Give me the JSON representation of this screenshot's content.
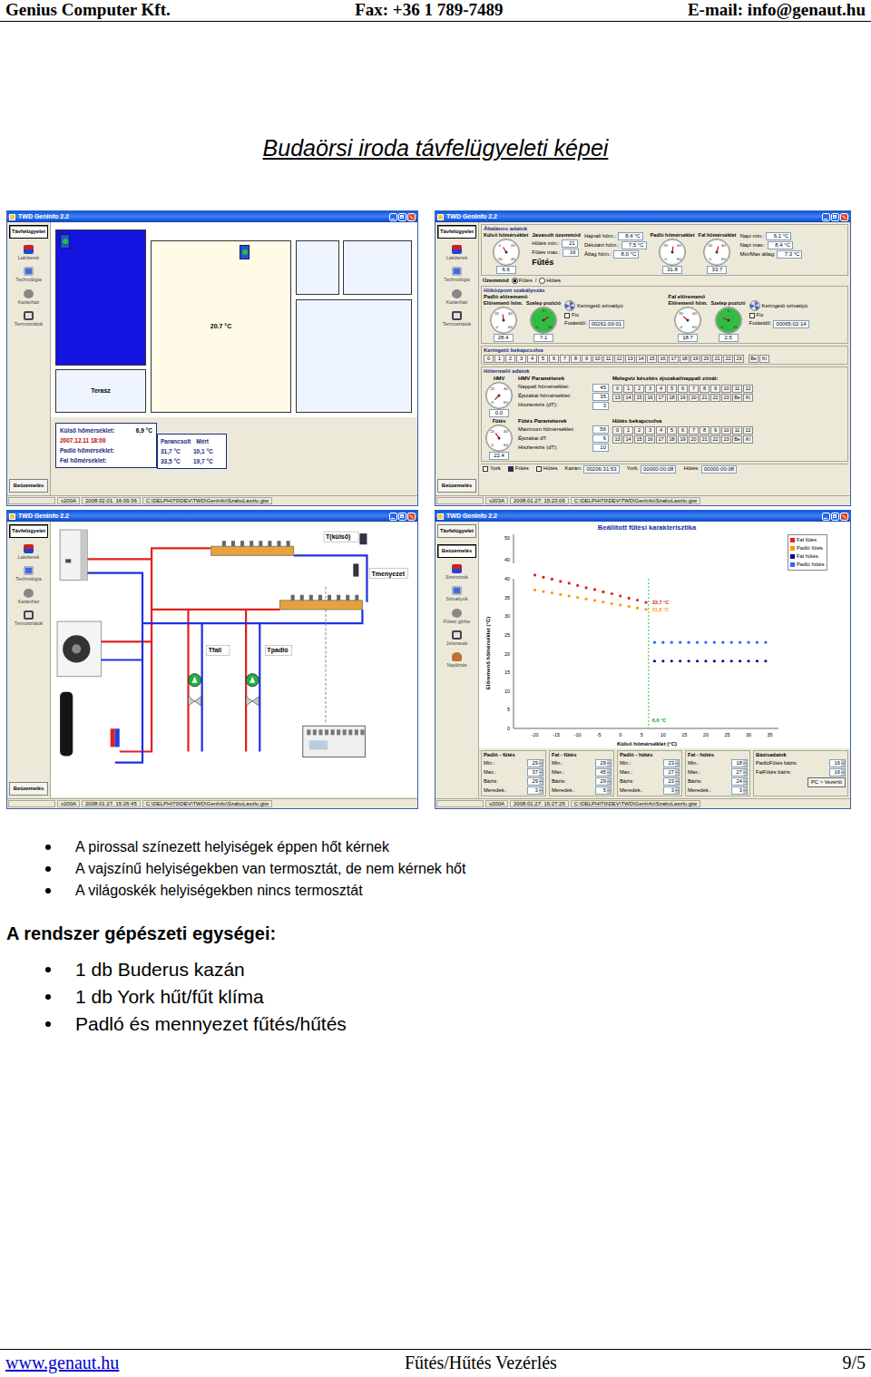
{
  "header": {
    "company": "Genius Computer Kft.",
    "fax": "Fax: +36 1 789-7489",
    "email": "E-mail: info@genaut.hu"
  },
  "title": "Budaörsi iroda távfelügyeleti képei",
  "screens": [
    {
      "kind": "plan",
      "title": "TWD GenInfo 2.2",
      "nav_top": [
        {
          "label": "Távfelügyelet",
          "selected": true
        }
      ],
      "nav_items": [
        "Lakóterek",
        "Technológia",
        "Kazánház",
        "Termosztátok"
      ],
      "nav_bottom": [
        {
          "label": "Beüzemelés",
          "selected": false
        }
      ],
      "status": [
        "v200A",
        "2008.02.01. 16:09:36",
        "C:\\DELPHI70\\DEV\\TWD\\GenInfo\\SzaboLaszlo.gtw"
      ],
      "rooms": [
        {
          "label": "",
          "color": "#1414e0",
          "thermostat": true
        },
        {
          "label": "Terasz",
          "color": "#eef4ff",
          "thermostat": false
        },
        {
          "label": "20.7 °C",
          "color": "#fffbe6",
          "thermostat": true
        },
        {
          "label": "",
          "color": "#eef4ff",
          "thermostat": false
        },
        {
          "label": "",
          "color": "#eef4ff",
          "thermostat": false
        },
        {
          "label": "",
          "color": "#eef4ff",
          "thermostat": false
        }
      ],
      "outdoor": {
        "label": "Külső hőmérséklet:",
        "value": "6,9 °C"
      },
      "timestamp": "2007.12.11 18:00",
      "table": {
        "columns": [
          "Parancsolt",
          "Mért"
        ],
        "rows": [
          {
            "label": "Padló hőmérséklet:",
            "values": [
              "31,7 °C",
              "10,1 °C"
            ]
          },
          {
            "label": "Fal hőmérséklet:",
            "values": [
              "33,5 °C",
              "19,7 °C"
            ]
          }
        ]
      }
    },
    {
      "kind": "dashboard",
      "title": "TWD GenInfo 2.2",
      "nav_top": [
        {
          "label": "Távfelügyelet",
          "selected": true
        }
      ],
      "nav_items": [
        "Lakóterek",
        "Technológia",
        "Kazánház",
        "Termosztátok"
      ],
      "nav_bottom": [
        {
          "label": "Beüzemelés",
          "selected": false
        }
      ],
      "status": [
        "v203A",
        "2008.01.27. 15:23:06",
        "C:\\DELPHI70\\DEV\\TWD\\GenInfo\\SzaboLaszlo.gtw"
      ],
      "general": {
        "title": "Általános adatok",
        "gauges_left": [
          {
            "label": "Külső hőmérséklet",
            "reading": "6.6",
            "level": 0.38,
            "ticks": [
              "-20",
              "0",
              "20",
              "40"
            ],
            "color": "#ffffff"
          }
        ],
        "mode_title": "Javasolt üzemmód",
        "mode_rows": [
          {
            "label": "Hűtés min.:",
            "value": "21"
          },
          {
            "label": "Fűtés max.:",
            "value": "16"
          }
        ],
        "mode_value": "Fűtés",
        "temps": [
          {
            "label": "Hajnali hőm.:",
            "value": "8,4 °C"
          },
          {
            "label": "Délutáni hőm.:",
            "value": "7,5 °C"
          },
          {
            "label": "Átlag hőm.:",
            "value": "8,0 °C"
          }
        ],
        "gauges_right": [
          {
            "label": "Padló hőmérséklet",
            "reading": "31.8",
            "level": 0.53,
            "ticks": [
              "0",
              "20",
              "40",
              "60"
            ],
            "color": "#ffffff"
          },
          {
            "label": "Fal hőmérséklet",
            "reading": "33.7",
            "level": 0.56,
            "ticks": [
              "0",
              "20",
              "40",
              "60"
            ],
            "color": "#ffffff"
          }
        ],
        "daily": [
          {
            "label": "Napi min.:",
            "value": "6,1 °C"
          },
          {
            "label": "Napi max.:",
            "value": "8,4 °C"
          },
          {
            "label": "Min/Max átlag:",
            "value": "7,3 °C"
          }
        ]
      },
      "mode": {
        "label": "Üzemmód",
        "options": [
          {
            "label": "Fűtés",
            "selected": true
          },
          {
            "label": "Hűtés",
            "selected": false
          }
        ],
        "separator": "/"
      },
      "central": {
        "title": "Hőközpont szabályozás",
        "circuits": [
          {
            "title": "Padló előremenő",
            "gauges": [
              {
                "label": "Előremenő hőm.",
                "reading": "28.4",
                "level": 0.47,
                "ticks": [
                  "0",
                  "20",
                  "40",
                  "60"
                ],
                "color": "#ffffff"
              },
              {
                "label": "Szelep pozíció",
                "reading": "7.1",
                "level": 0.71,
                "ticks": [
                  "0",
                  "5",
                  "10"
                ],
                "color": "#33bb44"
              }
            ],
            "pump_label": "Keringető szivattyú",
            "fix_label": "Fix",
            "fix_checked": false,
            "runtime_label": "Futásidő:",
            "runtime": "00261:00:01"
          },
          {
            "title": "Fal előremenő",
            "gauges": [
              {
                "label": "Előremenő hőm.",
                "reading": "18.7",
                "level": 0.31,
                "ticks": [
                  "0",
                  "20",
                  "40",
                  "60"
                ],
                "color": "#ffffff"
              },
              {
                "label": "Szelep pozíció",
                "reading": "2.5",
                "level": 0.25,
                "ticks": [
                  "0",
                  "5",
                  "10"
                ],
                "color": "#33bb44"
              }
            ],
            "pump_label": "Keringető szivattyú",
            "fix_label": "Fix",
            "fix_checked": false,
            "runtime_label": "Futásidő:",
            "runtime": "00065:02:14"
          }
        ]
      },
      "pump_schedule": {
        "title": "Keringető bekapcsolva",
        "hours": [
          "0",
          "1",
          "2",
          "3",
          "4",
          "5",
          "6",
          "7",
          "8",
          "9",
          "10",
          "11",
          "12",
          "13",
          "14",
          "15",
          "16",
          "17",
          "18",
          "19",
          "20",
          "21",
          "22",
          "23"
        ],
        "on": "Be",
        "off": "Ki"
      },
      "producer": {
        "title": "Hőtermelő adatok",
        "blocks": [
          {
            "gauge": {
              "label": "HMV",
              "reading": "0.0",
              "level": 0.0,
              "ticks": [
                "0",
                "20",
                "40",
                "60"
              ],
              "color": "#ffffff"
            },
            "params_title": "HMV Paraméterek",
            "params": [
              {
                "label": "Nappali hőmérséklet:",
                "value": "45"
              },
              {
                "label": "Éjszakai hőmérséklet:",
                "value": "35"
              },
              {
                "label": "Hiszterézis (dT):",
                "value": "3"
              }
            ],
            "schedule_title": "Melegvíz készítés éjszakai/nappali zónái:",
            "hours": [
              "0",
              "1",
              "2",
              "3",
              "4",
              "5",
              "6",
              "7",
              "8",
              "9",
              "10",
              "11",
              "12",
              "13",
              "14",
              "15",
              "16",
              "17",
              "18",
              "19",
              "20",
              "21",
              "22",
              "23"
            ],
            "on": "Be",
            "off": "Ki"
          },
          {
            "gauge": {
              "label": "Fűtés",
              "reading": "22.4",
              "level": 0.37,
              "ticks": [
                "0",
                "20",
                "40",
                "60"
              ],
              "color": "#ffffff"
            },
            "params_title": "Fűtés Paraméterek",
            "params": [
              {
                "label": "Maximum hőmérséklet:",
                "value": "56"
              },
              {
                "label": "Éjszakai dT:",
                "value": "6"
              },
              {
                "label": "Hiszterézis (dT):",
                "value": "10"
              }
            ],
            "schedule_title": "Hűtés bekapcsolva",
            "hours": [
              "0",
              "1",
              "2",
              "3",
              "4",
              "5",
              "6",
              "7",
              "8",
              "9",
              "10",
              "11",
              "12",
              "13",
              "14",
              "15",
              "16",
              "17",
              "18",
              "19",
              "20",
              "21",
              "22",
              "23"
            ],
            "on": "Be",
            "off": "Ki"
          }
        ]
      },
      "flags": [
        {
          "label": "York",
          "checked": false
        },
        {
          "label": "Fűtés",
          "checked": true
        },
        {
          "label": "Hűtés",
          "checked": false
        }
      ],
      "runtimes": [
        {
          "label": "Kazán:",
          "value": "00206:31:53"
        },
        {
          "label": "York:",
          "value": "00000:00:08"
        },
        {
          "label": "Hűtés:",
          "value": "00000:00:08"
        }
      ]
    },
    {
      "kind": "diagram",
      "title": "TWD GenInfo 2.2",
      "nav_top": [
        {
          "label": "Távfelügyelet",
          "selected": true
        }
      ],
      "nav_items": [
        "Lakóterek",
        "Technológia",
        "Kazánház",
        "Termosztátok"
      ],
      "nav_bottom": [
        {
          "label": "Beüzemelés",
          "selected": false
        }
      ],
      "status": [
        "v200A",
        "2008.01.27. 15:26:45",
        "C:\\DELPHI70\\DEV\\TWD\\GenInfo\\SzaboLaszlo.gtw"
      ],
      "sensors": [
        {
          "label": "T(külső)"
        },
        {
          "label": "Tmenyezet"
        },
        {
          "label": "Tfali"
        },
        {
          "label": "Tpadló"
        }
      ],
      "pumps": [
        {
          "on": true
        },
        {
          "on": true
        }
      ]
    },
    {
      "kind": "chart",
      "title": "TWD GenInfo 2.2",
      "nav_top": [
        {
          "label": "Távfelügyelet",
          "selected": false
        },
        {
          "label": "Beüzemelés",
          "selected": true
        }
      ],
      "nav_items": [
        "Szenzorok",
        "Szivattyúk",
        "Fűtési görbe",
        "Jelszavak",
        "Naplózás"
      ],
      "nav_bottom": [],
      "status": [
        "v200A",
        "2008.01.27. 15:27:25",
        "C:\\DELPHI70\\DEV\\TWD\\GenInfo\\SzaboLaszlo.gtw"
      ],
      "chart": {
        "title": "Beállított fűtési karakterisztika",
        "y_label": "Előremenő hőmérséklet (°C)",
        "x_label": "Külső hőmérséklet (°C)",
        "top_ticks": [
          "50",
          "40"
        ],
        "y_ticks": [
          "0",
          "5",
          "10",
          "15",
          "20",
          "25",
          "30",
          "35",
          "40"
        ],
        "x_ticks": [
          "-20",
          "-15",
          "-10",
          "-5",
          "0",
          "5",
          "10",
          "15",
          "20",
          "25",
          "30",
          "35"
        ],
        "series": [
          {
            "name": "Fal fűtés",
            "color": "#e02020",
            "x": [
              -20,
              -18,
              -16,
              -14,
              -12,
              -10,
              -8,
              -6,
              -4,
              -2,
              0,
              2,
              4,
              6
            ],
            "values": [
              41.0,
              40.4,
              39.9,
              39.3,
              38.8,
              38.2,
              37.6,
              37.1,
              36.5,
              36.0,
              35.4,
              34.8,
              34.3,
              33.7
            ]
          },
          {
            "name": "Padló fűtés",
            "color": "#ff9900",
            "x": [
              -20,
              -18,
              -16,
              -14,
              -12,
              -10,
              -8,
              -6,
              -4,
              -2,
              0,
              2,
              4,
              6
            ],
            "values": [
              37.0,
              36.6,
              36.2,
              35.8,
              35.4,
              35.0,
              34.6,
              34.2,
              33.8,
              33.4,
              33.0,
              32.6,
              32.2,
              31.8
            ]
          },
          {
            "name": "Fal hűtés",
            "color": "#0a0a90",
            "x": [
              8,
              10,
              12,
              14,
              16,
              18,
              20,
              22,
              24,
              26,
              28,
              30,
              32,
              34
            ],
            "values": [
              18,
              18,
              18,
              18,
              18,
              18,
              18,
              18,
              18,
              18,
              18,
              18,
              18,
              18
            ]
          },
          {
            "name": "Padló hűtés",
            "color": "#3366ff",
            "x": [
              8,
              10,
              12,
              14,
              16,
              18,
              20,
              22,
              24,
              26,
              28,
              30,
              32,
              34
            ],
            "values": [
              23,
              23,
              23,
              23,
              23,
              23,
              23,
              23,
              23,
              23,
              23,
              23,
              23,
              23
            ]
          }
        ],
        "outdoor": {
          "value": 6.6,
          "label": "6,6 °C",
          "color": "#10a010"
        },
        "points": [
          {
            "value": 33.7,
            "label": "33,7 °C",
            "color": "#e02020"
          },
          {
            "value": 31.8,
            "label": "31,8 °C",
            "color": "#ff9900"
          }
        ]
      },
      "param_groups": [
        {
          "title": "Padló - fűtés",
          "rows": [
            {
              "label": "Min.:",
              "value": "29"
            },
            {
              "label": "Max.:",
              "value": "37"
            },
            {
              "label": "Bázis:",
              "value": "29"
            },
            {
              "label": "Meredek.:",
              "value": "3"
            }
          ]
        },
        {
          "title": "Fal - fűtés",
          "rows": [
            {
              "label": "Min.:",
              "value": "29"
            },
            {
              "label": "Max.:",
              "value": "45"
            },
            {
              "label": "Bázis:",
              "value": "29"
            },
            {
              "label": "Meredek.:",
              "value": "5"
            }
          ]
        },
        {
          "title": "Padló - hűtés",
          "rows": [
            {
              "label": "Min.:",
              "value": "23"
            },
            {
              "label": "Max.:",
              "value": "27"
            },
            {
              "label": "Bázis:",
              "value": "23"
            },
            {
              "label": "Meredek.:",
              "value": "3"
            }
          ]
        },
        {
          "title": "Fal - hűtés",
          "rows": [
            {
              "label": "Min.:",
              "value": "18"
            },
            {
              "label": "Max.:",
              "value": "27"
            },
            {
              "label": "Bázis:",
              "value": "24"
            },
            {
              "label": "Meredek.:",
              "value": "3"
            }
          ]
        }
      ],
      "base": {
        "title": "Bázisadatok",
        "rows": [
          {
            "label": "PadlóFűtés bázis:",
            "value": "16"
          },
          {
            "label": "FalFűtés bázis:",
            "value": "16"
          }
        ],
        "button": "PC > Vezérlő"
      }
    }
  ],
  "legend_notes": [
    "A pirossal színezett helyiségek éppen hőt kérnek",
    "A vajszínű helyiségekben van termosztát, de nem kérnek hőt",
    "A világoskék helyiségekben nincs termosztát"
  ],
  "units_title": "A rendszer gépészeti egységei:",
  "units": [
    "1 db Buderus kazán",
    "1 db York hűt/fűt klíma",
    "Padló és mennyezet fűtés/hűtés"
  ],
  "footer": {
    "link": "www.genaut.hu",
    "title": "Fűtés/Hűtés Vezérlés",
    "page": "9/5"
  }
}
